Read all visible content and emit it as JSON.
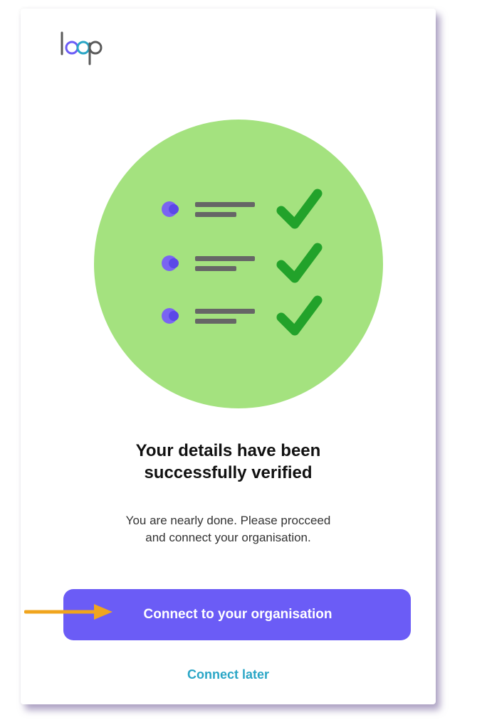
{
  "brand": {
    "logo_text": "loop"
  },
  "verification": {
    "title": "Your details have been successfully verified",
    "subtitle": "You are nearly done. Please procceed and connect your organisation."
  },
  "actions": {
    "primary_label": "Connect to your organisation",
    "secondary_label": "Connect later"
  },
  "colors": {
    "accent": "#6b5cf6",
    "link": "#2aa6c6",
    "hero_circle": "#a4e27f",
    "check": "#22a22a",
    "arrow": "#f0a51e"
  },
  "illustration": {
    "items": [
      "checklist-item",
      "checklist-item",
      "checklist-item"
    ]
  }
}
